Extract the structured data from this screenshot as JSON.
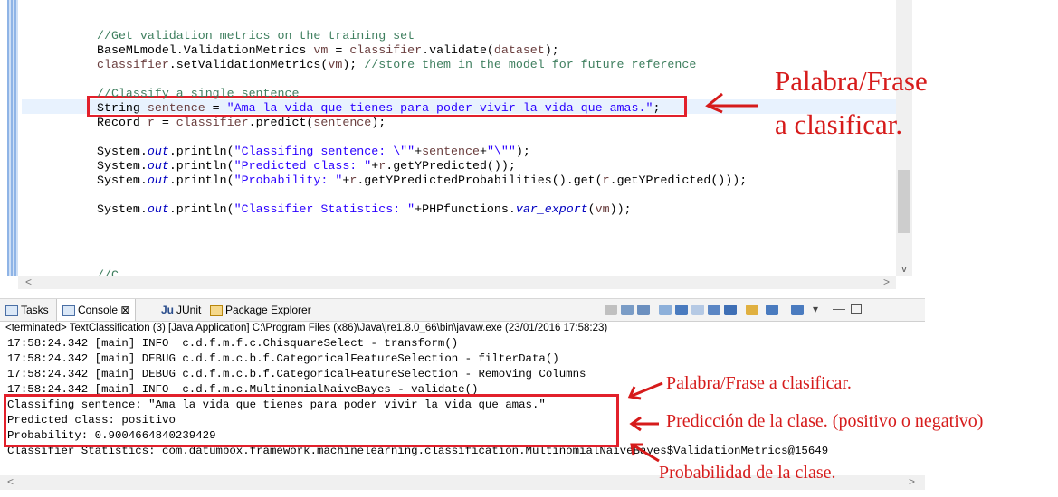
{
  "editor": {
    "lines": [
      {
        "parts": [
          {
            "t": "//Get validation metrics on the training set",
            "c": "cm"
          }
        ]
      },
      {
        "parts": [
          {
            "t": "BaseMLmodel.ValidationMetrics "
          },
          {
            "t": "vm",
            "c": "vr"
          },
          {
            "t": " = "
          },
          {
            "t": "classifier",
            "c": "vr"
          },
          {
            "t": ".validate("
          },
          {
            "t": "dataset",
            "c": "vr"
          },
          {
            "t": ");"
          }
        ]
      },
      {
        "parts": [
          {
            "t": "classifier",
            "c": "vr"
          },
          {
            "t": ".setValidationMetrics("
          },
          {
            "t": "vm",
            "c": "vr"
          },
          {
            "t": "); "
          },
          {
            "t": "//store them in the model for future reference",
            "c": "cm"
          }
        ]
      },
      {
        "parts": [
          {
            "t": ""
          }
        ]
      },
      {
        "parts": [
          {
            "t": "//Classify a single sentence",
            "c": "cm"
          }
        ]
      },
      {
        "parts": [
          {
            "t": "String "
          },
          {
            "t": "sentence",
            "c": "vr"
          },
          {
            "t": " = "
          },
          {
            "t": "\"Ama la vida que tienes para poder vivir la vida que amas.\"",
            "c": "str"
          },
          {
            "t": ";"
          }
        ]
      },
      {
        "parts": [
          {
            "t": "Record "
          },
          {
            "t": "r",
            "c": "vr"
          },
          {
            "t": " = "
          },
          {
            "t": "classifier",
            "c": "vr"
          },
          {
            "t": ".predict("
          },
          {
            "t": "sentence",
            "c": "vr"
          },
          {
            "t": ");"
          }
        ]
      },
      {
        "parts": [
          {
            "t": ""
          }
        ]
      },
      {
        "parts": [
          {
            "t": "System."
          },
          {
            "t": "out",
            "c": "fld"
          },
          {
            "t": ".println("
          },
          {
            "t": "\"Classifing sentence: \\\"\"",
            "c": "str"
          },
          {
            "t": "+"
          },
          {
            "t": "sentence",
            "c": "vr"
          },
          {
            "t": "+"
          },
          {
            "t": "\"\\\"\"",
            "c": "str"
          },
          {
            "t": ");"
          }
        ]
      },
      {
        "parts": [
          {
            "t": "System."
          },
          {
            "t": "out",
            "c": "fld"
          },
          {
            "t": ".println("
          },
          {
            "t": "\"Predicted class: \"",
            "c": "str"
          },
          {
            "t": "+"
          },
          {
            "t": "r",
            "c": "vr"
          },
          {
            "t": ".getYPredicted());"
          }
        ]
      },
      {
        "parts": [
          {
            "t": "System."
          },
          {
            "t": "out",
            "c": "fld"
          },
          {
            "t": ".println("
          },
          {
            "t": "\"Probability: \"",
            "c": "str"
          },
          {
            "t": "+"
          },
          {
            "t": "r",
            "c": "vr"
          },
          {
            "t": ".getYPredictedProbabilities().get("
          },
          {
            "t": "r",
            "c": "vr"
          },
          {
            "t": ".getYPredicted()));"
          }
        ]
      },
      {
        "parts": [
          {
            "t": ""
          }
        ]
      },
      {
        "parts": [
          {
            "t": "System."
          },
          {
            "t": "out",
            "c": "fld"
          },
          {
            "t": ".println("
          },
          {
            "t": "\"Classifier Statistics: \"",
            "c": "str"
          },
          {
            "t": "+PHPfunctions."
          },
          {
            "t": "var_export",
            "c": "fld"
          },
          {
            "t": "("
          },
          {
            "t": "vm",
            "c": "vr"
          },
          {
            "t": "));"
          }
        ]
      }
    ],
    "partial_line": "//C",
    "scroll_left_arrow": "<",
    "scroll_right_arrow": ">",
    "scroll_down_arrow": "v"
  },
  "annotations": {
    "top_line1": "Palabra/Frase",
    "top_line2": "a clasificar.",
    "console_1": "Palabra/Frase a clasificar.",
    "console_2": "Predicción de la clase. (positivo o negativo)",
    "console_3": "Probabilidad de la clase.",
    "color": "#d61b1b"
  },
  "console": {
    "tabs": [
      {
        "label": "Tasks"
      },
      {
        "label": "Console ⊠"
      },
      {
        "label": "JUnit"
      },
      {
        "label": "Package Explorer"
      }
    ],
    "terminated": "<terminated> TextClassification (3) [Java Application] C:\\Program Files (x86)\\Java\\jre1.8.0_66\\bin\\javaw.exe (23/01/2016 17:58:23)",
    "lines": [
      "17:58:24.342 [main] INFO  c.d.f.m.f.c.ChisquareSelect - transform()",
      "17:58:24.342 [main] DEBUG c.d.f.m.c.b.f.CategoricalFeatureSelection - filterData()",
      "17:58:24.342 [main] DEBUG c.d.f.m.c.b.f.CategoricalFeatureSelection - Removing Columns",
      "17:58:24.342 [main] INFO  c.d.f.m.c.MultinomialNaiveBayes - validate()",
      "Classifing sentence: \"Ama la vida que tienes para poder vivir la vida que amas.\"",
      "Predicted class: positivo",
      "Probability: 0.9004664840239429",
      "Classifier Statistics: com.datumbox.framework.machinelearning.classification.MultinomialNaiveBayes$ValidationMetrics@15649"
    ]
  }
}
